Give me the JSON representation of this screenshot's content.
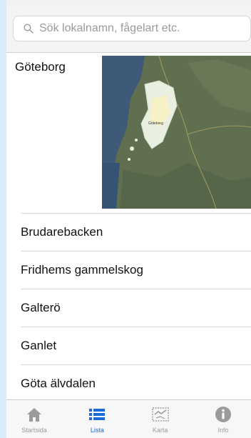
{
  "search": {
    "placeholder": "Sök lokalnamn, fågelart etc."
  },
  "region": {
    "title": "Göteborg",
    "map_city_label": "Göteborg"
  },
  "list": {
    "items": [
      {
        "label": "Brudarebacken"
      },
      {
        "label": "Fridhems gammelskog"
      },
      {
        "label": "Galterö"
      },
      {
        "label": "Ganlet"
      },
      {
        "label": "Göta älvdalen"
      }
    ]
  },
  "tabbar": {
    "tabs": [
      {
        "label": "Startsida",
        "icon": "home-icon",
        "active": false
      },
      {
        "label": "Lista",
        "icon": "list-icon",
        "active": true
      },
      {
        "label": "Karta",
        "icon": "map-icon",
        "active": false
      },
      {
        "label": "Info",
        "icon": "info-icon",
        "active": false
      }
    ]
  },
  "colors": {
    "background": "#dbeaf7",
    "accent": "#1a6bd6",
    "inactive_tab": "#9b9b9b"
  }
}
